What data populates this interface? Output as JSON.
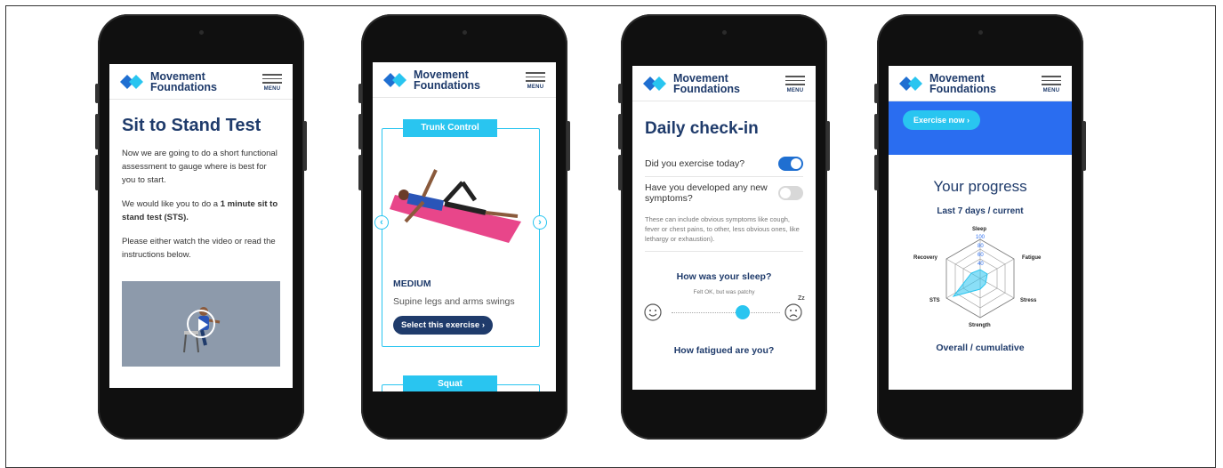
{
  "brand": {
    "line1": "Movement",
    "line2": "Foundations",
    "menu_label": "MENU"
  },
  "screen1": {
    "title": "Sit to Stand Test",
    "para1": "Now we are going to do a short functional assessment to gauge where is best for you to start.",
    "para2_pre": "We would like you to do a ",
    "para2_bold": "1 minute sit to stand test (STS).",
    "para3": "Please either watch the video or read the instructions below."
  },
  "screen2": {
    "card1_tab": "Trunk Control",
    "difficulty": "MEDIUM",
    "exercise": "Supine legs and arms swings",
    "select_label": "Select this exercise",
    "card2_tab": "Squat"
  },
  "screen3": {
    "title": "Daily check-in",
    "q1": "Did you exercise today?",
    "q2": "Have you developed any new symptoms?",
    "note": "These can include obvious symptoms like cough, fever or chest pains, to other, less obvious ones, like lethargy or exhaustion).",
    "sleep_q": "How was your sleep?",
    "sleep_value": "Felt OK, but was patchy",
    "fatigue_q": "How fatigued are you?",
    "zz": "Zz"
  },
  "screen4": {
    "exercise_now": "Exercise now",
    "progress_title": "Your progress",
    "last7": "Last 7 days / current",
    "overall": "Overall / cumulative",
    "radar_labels": [
      "Sleep",
      "Fatigue",
      "Stress",
      "Strength",
      "STS",
      "Recovery"
    ],
    "radar_ticks": [
      "100",
      "80",
      "60",
      "40"
    ]
  },
  "colors": {
    "navy": "#1f3b6b",
    "cyan": "#29c5f0",
    "blue": "#2a6df0"
  }
}
